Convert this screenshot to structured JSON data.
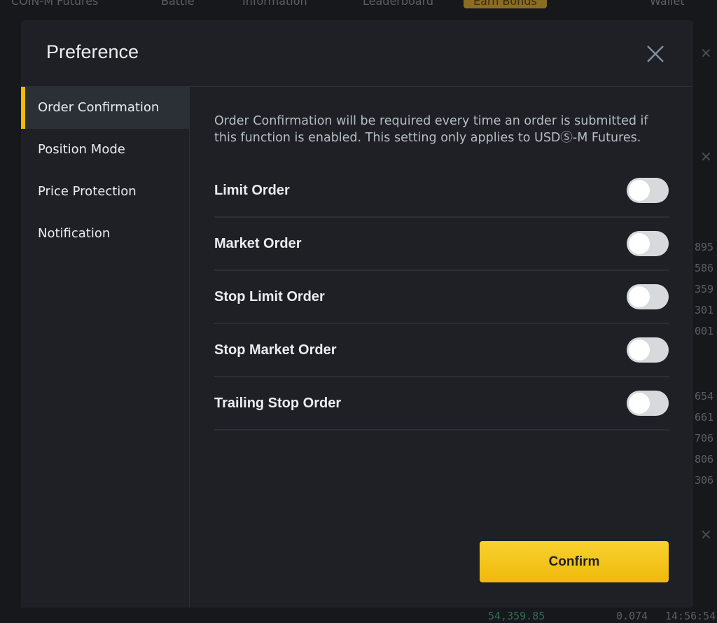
{
  "background": {
    "nav": [
      "COIN-M Futures",
      "Battle",
      "Information",
      "Leaderboard",
      "Earn Bonds",
      "Wallet"
    ],
    "order_book_values": [
      "895",
      "586",
      "359",
      "301",
      "001",
      "654",
      "661",
      "706",
      "806",
      "306"
    ],
    "bottom_price": "54,359.85",
    "bottom_qty": "0.074",
    "bottom_time": "14:56:54"
  },
  "modal": {
    "title": "Preference",
    "close_icon": "close-icon",
    "sidebar": {
      "items": [
        {
          "label": "Order Confirmation",
          "active": true
        },
        {
          "label": "Position Mode",
          "active": false
        },
        {
          "label": "Price Protection",
          "active": false
        },
        {
          "label": "Notification",
          "active": false
        }
      ]
    },
    "description": "Order Confirmation will be required every time an order is submitted if this function is enabled. This setting only applies to USDⓈ-M Futures.",
    "options": [
      {
        "label": "Limit Order",
        "enabled": false
      },
      {
        "label": "Market Order",
        "enabled": false
      },
      {
        "label": "Stop Limit Order",
        "enabled": false
      },
      {
        "label": "Stop Market Order",
        "enabled": false
      },
      {
        "label": "Trailing Stop Order",
        "enabled": false
      }
    ],
    "confirm_label": "Confirm"
  },
  "colors": {
    "accent": "#f0b90b",
    "modal_bg": "#1e2026",
    "active_item_bg": "#2b2f36"
  }
}
